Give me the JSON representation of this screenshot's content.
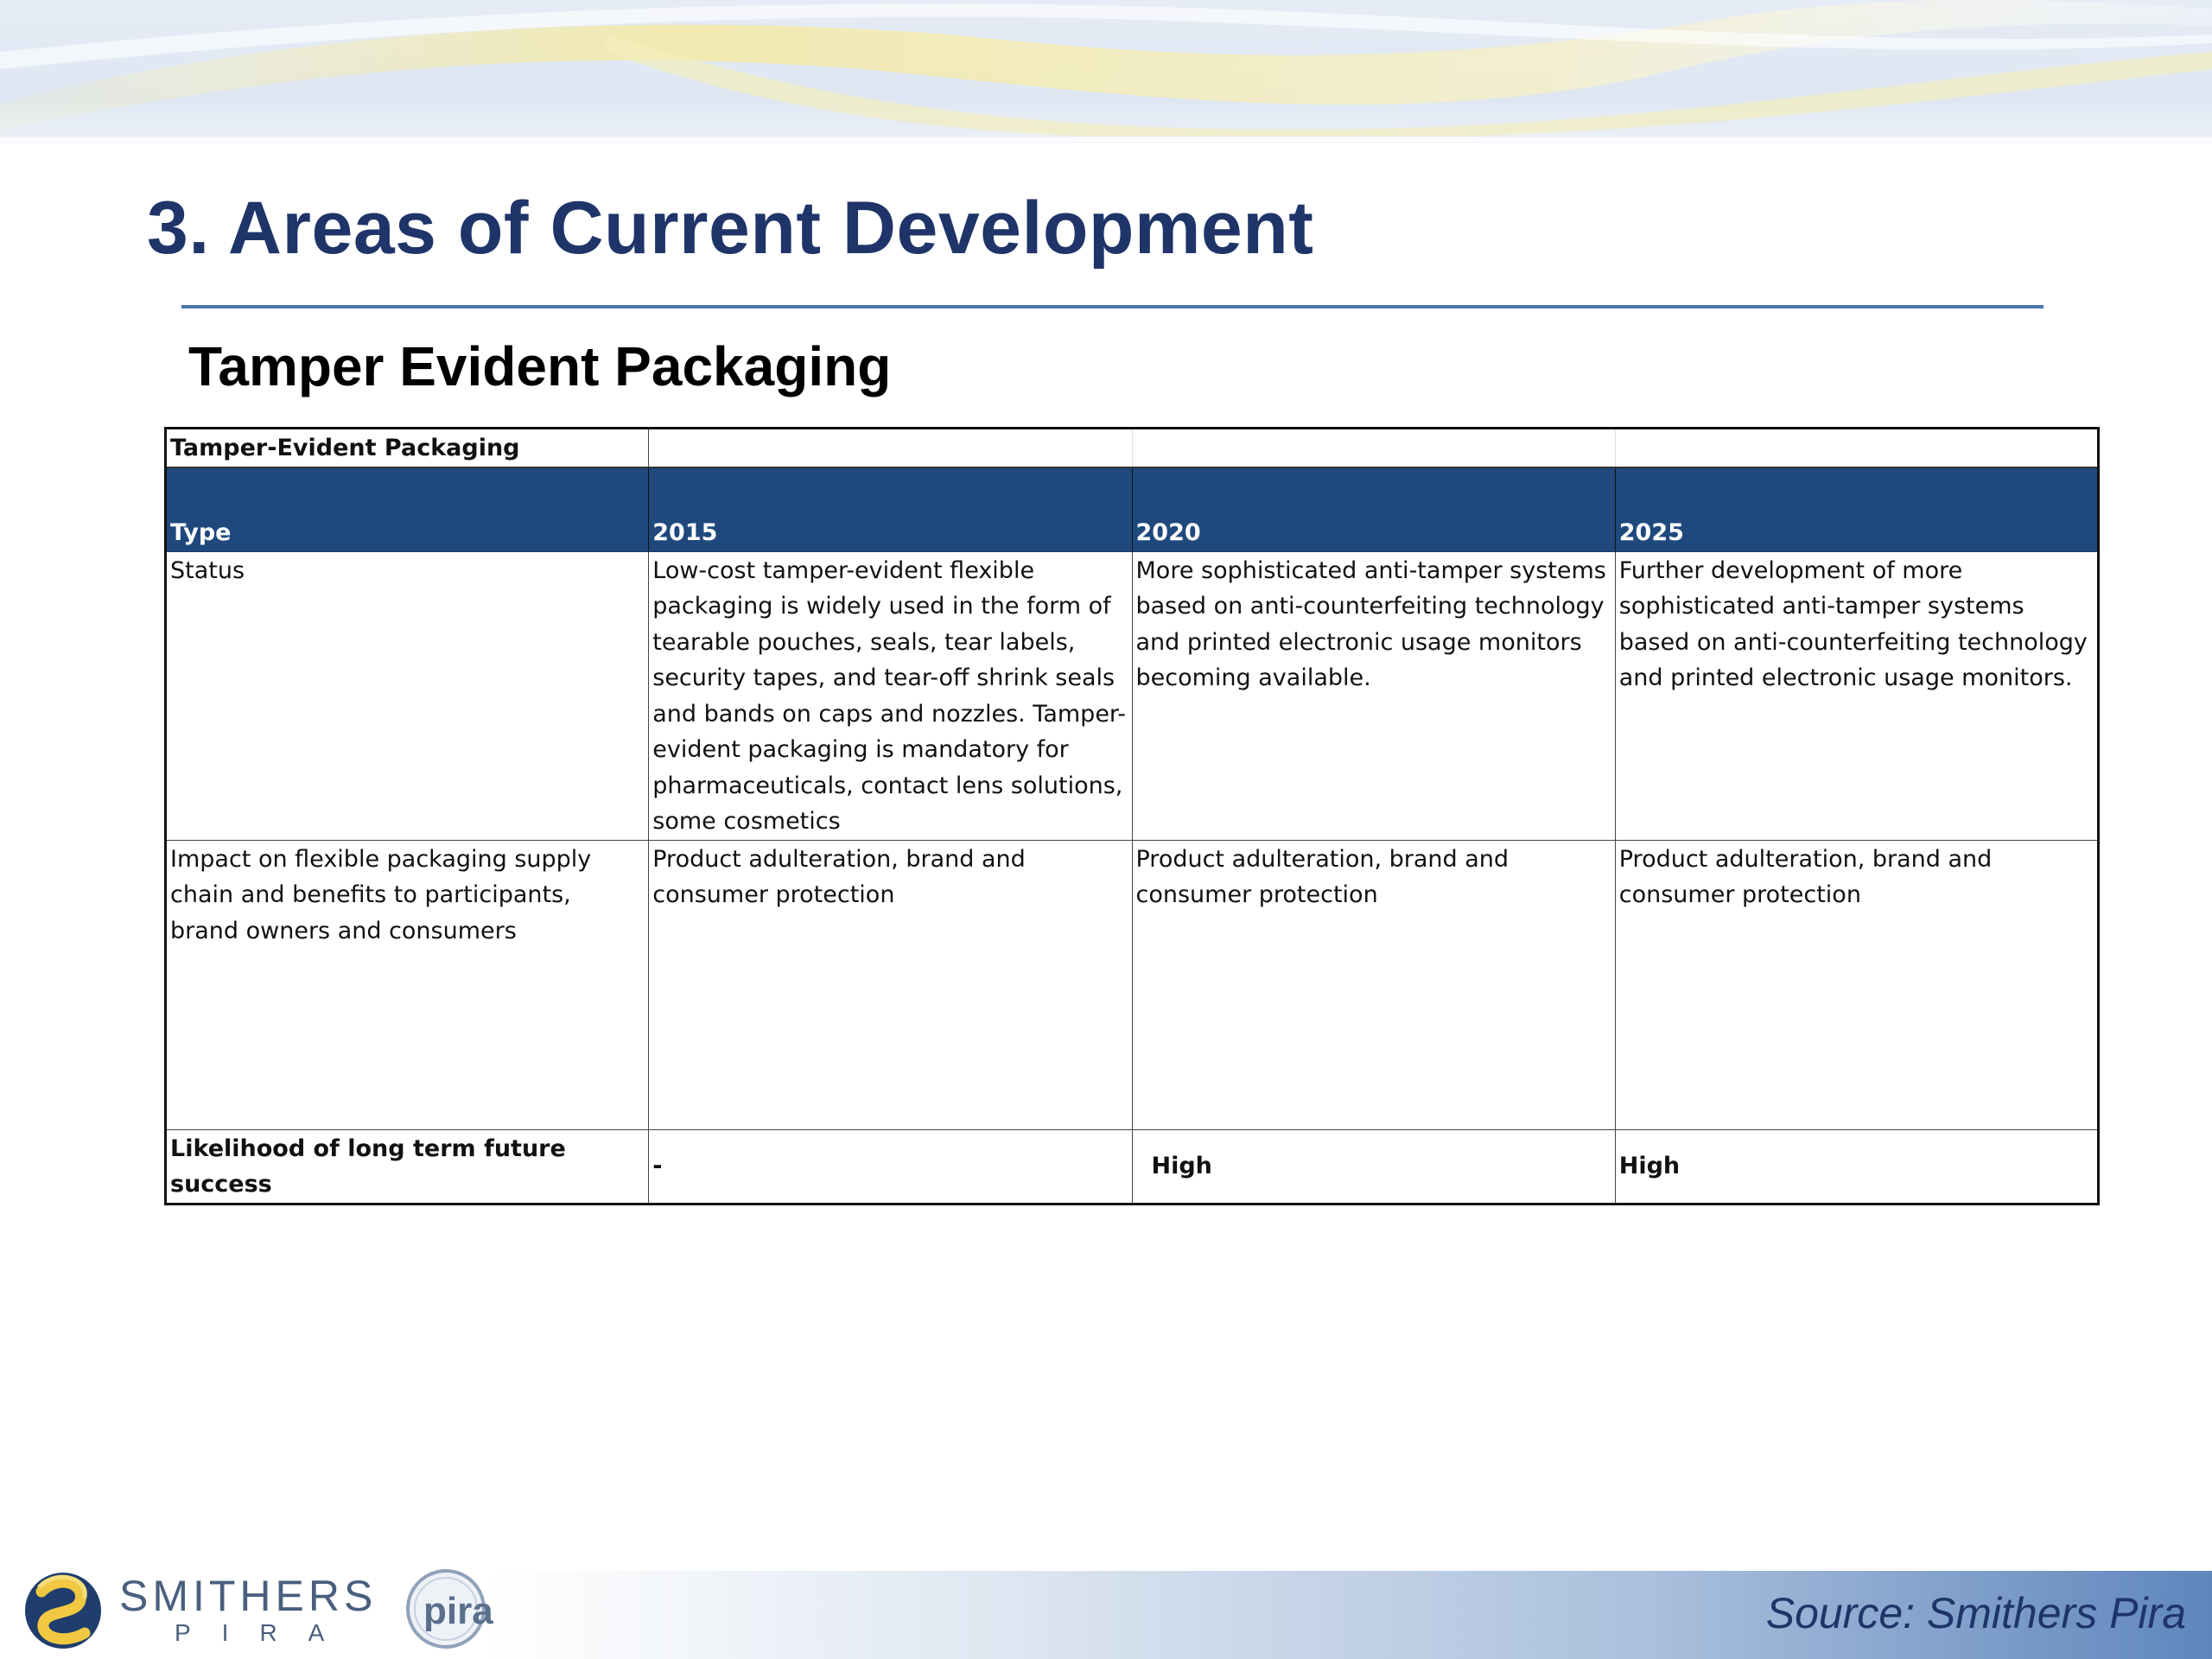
{
  "slide": {
    "title": "3. Areas of Current Development",
    "subtitle": "Tamper Evident Packaging"
  },
  "table": {
    "caption": "Tamper-Evident Packaging",
    "headers": [
      "Type",
      "2015",
      "2020",
      "2025"
    ],
    "rows": [
      {
        "label": "Status",
        "cells": [
          "Low-cost tamper-evident flexible packaging is widely used  in the form of tearable  pouches,  seals, tear labels, security tapes, and tear-off shrink seals and bands on caps and nozzles. Tamper-evident packaging is mandatory for pharmaceuticals, contact lens solutions, some cosmetics",
          "More sophisticated anti-tamper systems based on anti-counterfeiting technology and printed electronic usage monitors becoming available.",
          "Further development of more sophisticated anti-tamper systems based on anti-counterfeiting technology and printed electronic usage monitors."
        ]
      },
      {
        "label": "Impact on flexible packaging supply chain and benefits to participants, brand owners and consumers",
        "cells": [
          "Product adulteration, brand and consumer protection",
          "Product adulteration, brand and consumer protection",
          "Product adulteration, brand and consumer protection"
        ]
      },
      {
        "label": "Likelihood of long term future success",
        "cells": [
          "-",
          "High",
          "High"
        ]
      }
    ]
  },
  "footer": {
    "source": "Source: Smithers Pira",
    "logo_name": "SMITHERS",
    "logo_sub": "PIRA",
    "logo_badge": "pira"
  },
  "colors": {
    "title": "#1f3468",
    "header_fill": "#1f497d",
    "rule": "#4a76ad"
  }
}
